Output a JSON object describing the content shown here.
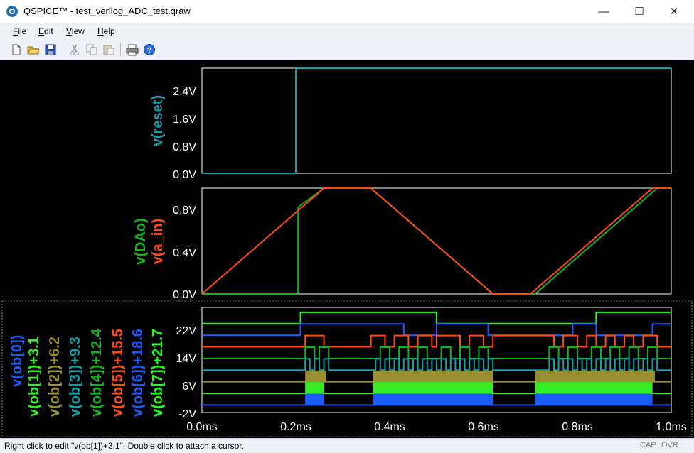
{
  "window": {
    "title": "QSPICE™ - test_verilog_ADC_test.qraw",
    "minimize": "—",
    "maximize": "☐",
    "close": "✕"
  },
  "menu": [
    {
      "label": "File",
      "ul": "F"
    },
    {
      "label": "Edit",
      "ul": "E"
    },
    {
      "label": "View",
      "ul": "V"
    },
    {
      "label": "Help",
      "ul": "H"
    }
  ],
  "toolbar": [
    "new-icon",
    "open-icon",
    "save-icon",
    "cut-icon",
    "copy-icon",
    "paste-icon",
    "print-icon",
    "help-icon"
  ],
  "status": {
    "text": "Right click to edit \"v(ob[1])+3.1\".  Double click to attach a cursor.",
    "cap": "CAP",
    "ovr": "OVR"
  },
  "colors": {
    "teal": "#14a0a8",
    "green": "#17b023",
    "orange": "#ff4c14",
    "blue": "#1a5cff",
    "lime": "#33ee22",
    "olive": "#9a8f2e",
    "bright_green": "#22ff22"
  },
  "chart_data": [
    {
      "type": "line",
      "title": "",
      "xlabel": "",
      "ylabel": "v(reset)",
      "ylim": [
        0,
        2.8
      ],
      "yticks": [
        "2.4V",
        "1.6V",
        "0.8V",
        "0.0V"
      ],
      "ytick_values": [
        2.4,
        1.6,
        0.8,
        0.0
      ],
      "series": [
        {
          "name": "v(reset)",
          "color": "#14a0a8",
          "x": [
            0,
            0.2,
            0.2,
            1.0
          ],
          "y": [
            0,
            0,
            2.8,
            2.8
          ]
        }
      ]
    },
    {
      "type": "line",
      "xlabel": "",
      "ylabel": "v(DAo) v(a_in)",
      "ylim": [
        0,
        1.0
      ],
      "yticks": [
        "0.8V",
        "0.4V",
        "0.0V"
      ],
      "ytick_values": [
        0.8,
        0.4,
        0.0
      ],
      "series": [
        {
          "name": "v(DAo)",
          "color": "#17b023",
          "x": [
            0,
            0.205,
            0.205,
            0.26,
            0.36,
            0.62,
            0.71,
            0.97,
            1.0
          ],
          "y": [
            0,
            0,
            0.82,
            1.0,
            1.0,
            0,
            0,
            1.0,
            1.0
          ]
        },
        {
          "name": "v(a_in)",
          "color": "#ff4c14",
          "x": [
            0,
            0.26,
            0.36,
            0.62,
            0.7,
            0.96,
            1.0
          ],
          "y": [
            0,
            1.0,
            1.0,
            0,
            0,
            1.0,
            1.0
          ]
        }
      ]
    },
    {
      "type": "line",
      "xlabel": "",
      "ylabel": "v(ob[0]) … v(ob[7])+21.7",
      "ylim": [
        -2,
        26
      ],
      "yticks": [
        "22V",
        "14V",
        "6V",
        "-2V"
      ],
      "ytick_values": [
        22,
        14,
        6,
        -2
      ],
      "x_ticks": [
        "0.0ms",
        "0.2ms",
        "0.4ms",
        "0.6ms",
        "0.8ms",
        "1.0ms"
      ],
      "x_tick_values": [
        0,
        0.2,
        0.4,
        0.6,
        0.8,
        1.0
      ],
      "series": [
        {
          "name": "v(ob[0])",
          "color": "#1a5cff"
        },
        {
          "name": "v(ob[1])+3.1",
          "color": "#33ee22"
        },
        {
          "name": "v(ob[2])+6.2",
          "color": "#9a8f2e"
        },
        {
          "name": "v(ob[3])+9.3",
          "color": "#14a0a8"
        },
        {
          "name": "v(ob[4])+12.4",
          "color": "#17b023"
        },
        {
          "name": "v(ob[5])+15.5",
          "color": "#ff4c14"
        },
        {
          "name": "v(ob[6])+18.6",
          "color": "#1a5cff"
        },
        {
          "name": "v(ob[7])+21.7",
          "color": "#22ff22"
        }
      ]
    }
  ]
}
